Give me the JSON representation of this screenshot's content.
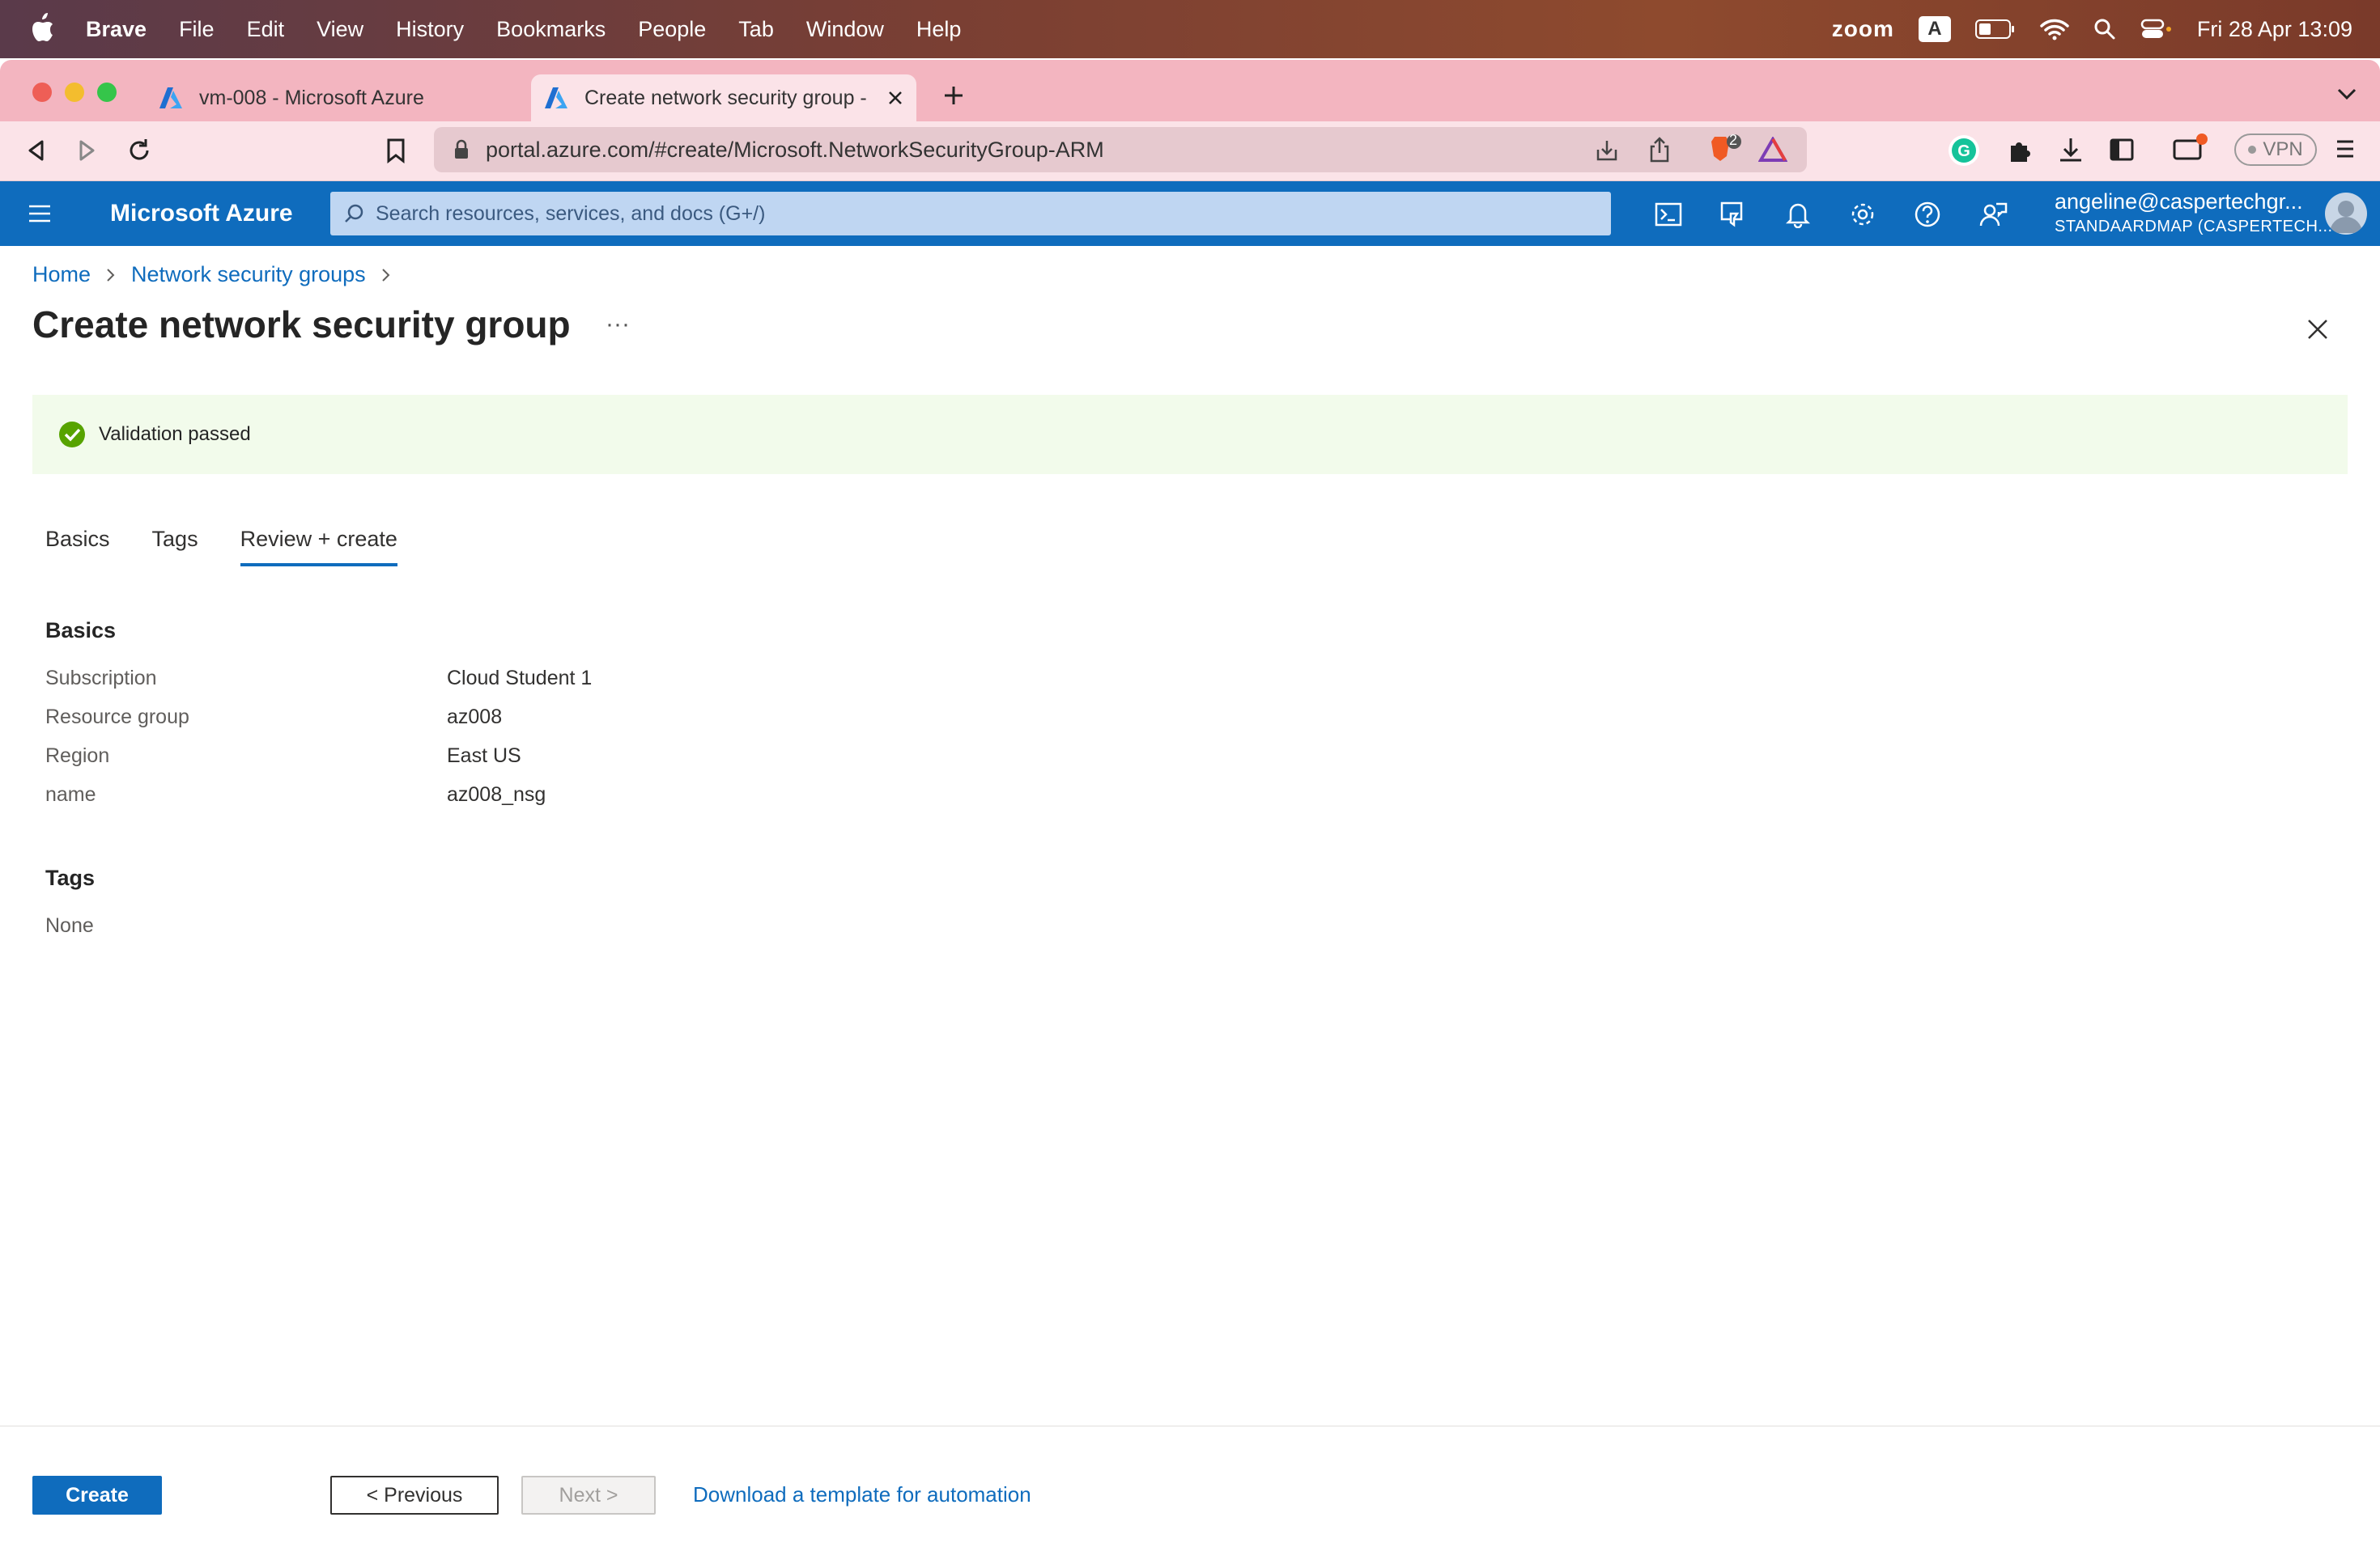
{
  "menubar": {
    "app": "Brave",
    "items": [
      "File",
      "Edit",
      "View",
      "History",
      "Bookmarks",
      "People",
      "Tab",
      "Window",
      "Help"
    ],
    "zoom": "zoom",
    "input_source": "A",
    "datetime": "Fri 28 Apr  13:09"
  },
  "browser": {
    "tabs": [
      {
        "title": "vm-008 - Microsoft Azure"
      },
      {
        "title": "Create network security group -"
      }
    ],
    "url": "portal.azure.com/#create/Microsoft.NetworkSecurityGroup-ARM",
    "brave_badge": "2",
    "vpn_label": "VPN"
  },
  "azure": {
    "brand": "Microsoft Azure",
    "search_placeholder": "Search resources, services, and docs (G+/)",
    "account_user": "angeline@caspertechgr...",
    "account_tenant": "STANDAARDMAP (CASPERTECH..."
  },
  "page": {
    "breadcrumb": [
      "Home",
      "Network security groups"
    ],
    "title": "Create network security group",
    "more": "···",
    "validation": "Validation passed",
    "tabs": [
      "Basics",
      "Tags",
      "Review + create"
    ],
    "active_tab": "Review + create",
    "basics_heading": "Basics",
    "basics": [
      {
        "label": "Subscription",
        "value": "Cloud Student 1"
      },
      {
        "label": "Resource group",
        "value": "az008"
      },
      {
        "label": "Region",
        "value": "East US"
      },
      {
        "label": "name",
        "value": "az008_nsg"
      }
    ],
    "tags_heading": "Tags",
    "tags_value": "None"
  },
  "footer": {
    "create": "Create",
    "previous": "< Previous",
    "next": "Next >",
    "download": "Download a template for automation"
  },
  "colors": {
    "azure_blue": "#0f6cbd",
    "tab_strip": "#f3b5c0",
    "success": "#57a300",
    "banner_bg": "#f2fbeb"
  }
}
